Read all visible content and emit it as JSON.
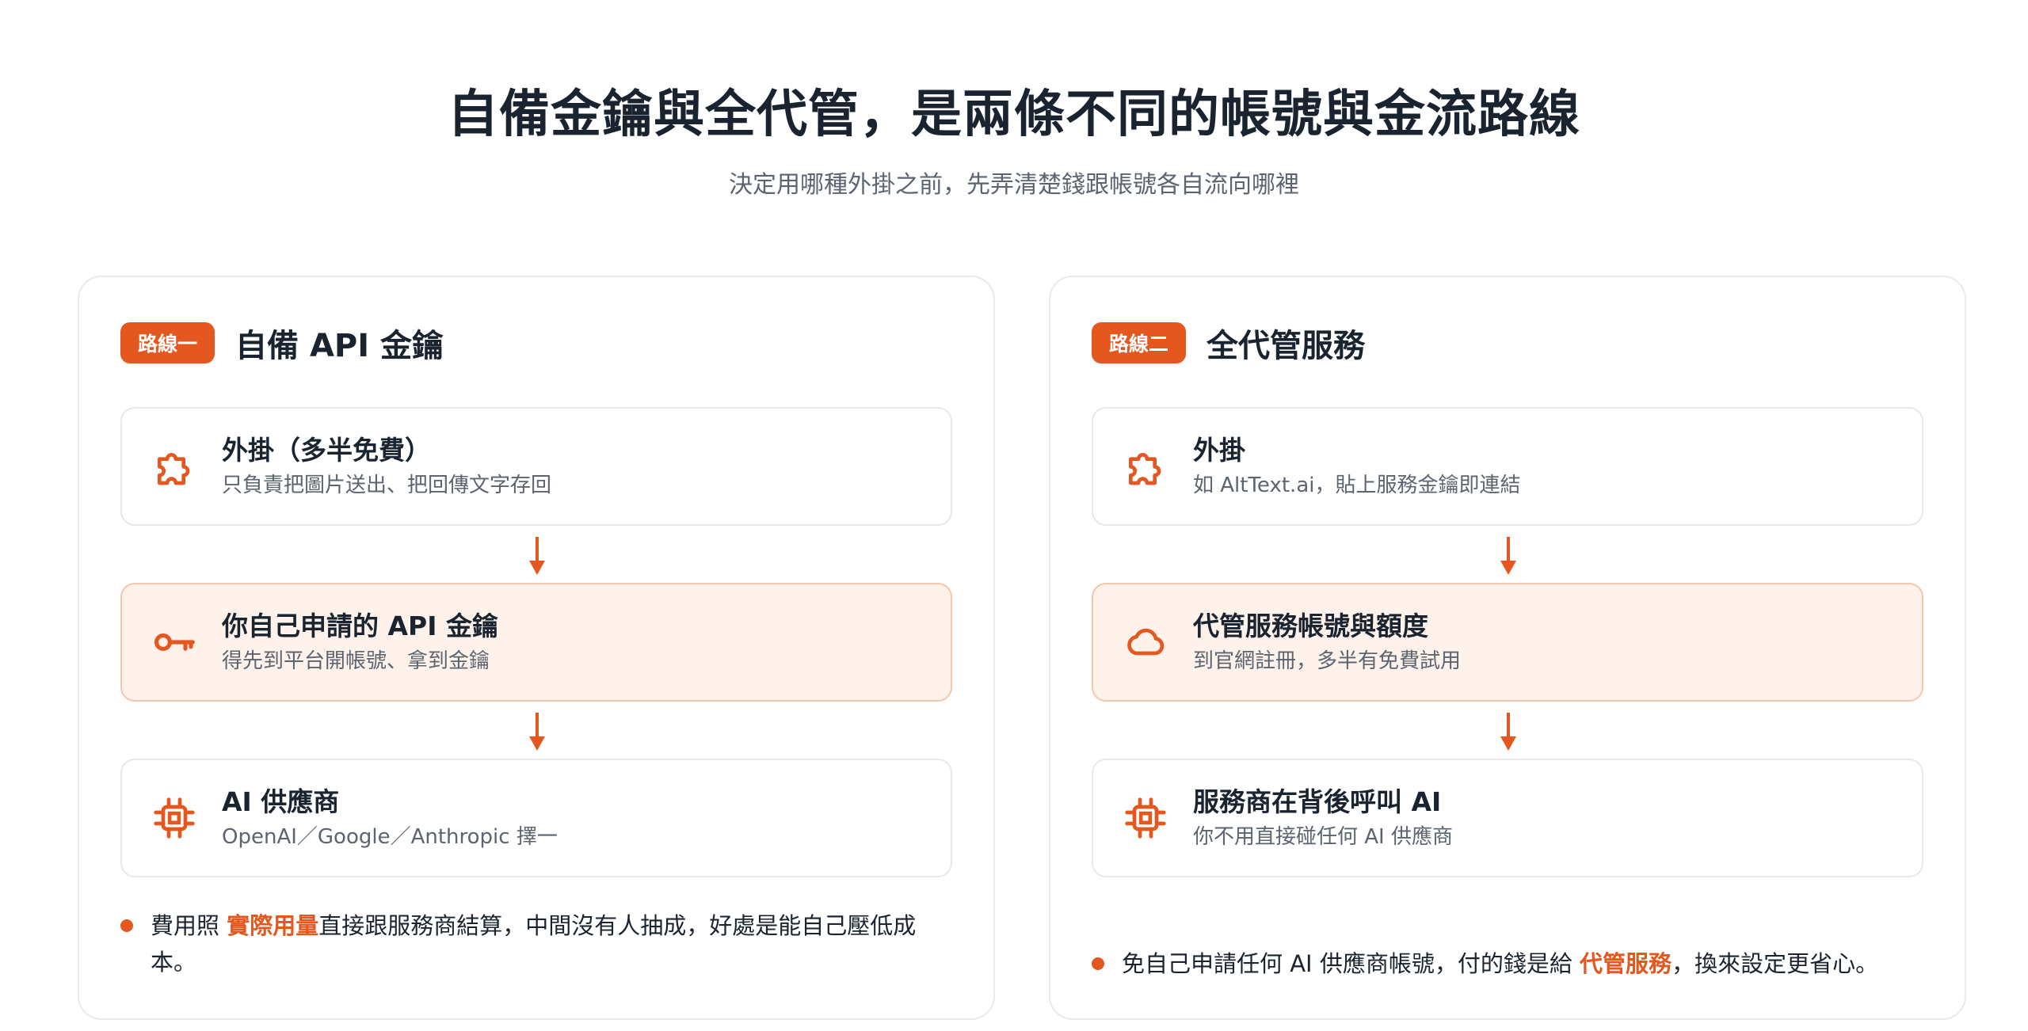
{
  "header": {
    "title": "自備金鑰與全代管，是兩條不同的帳號與金流路線",
    "subtitle": "決定用哪種外掛之前，先弄清楚錢跟帳號各自流向哪裡"
  },
  "routes": [
    {
      "badge": "路線一",
      "title": "自備 API 金鑰",
      "steps": [
        {
          "icon": "puzzle-icon",
          "title": "外掛（多半免費）",
          "desc": "只負責把圖片送出、把回傳文字存回"
        },
        {
          "icon": "key-icon",
          "title": "你自己申請的 API 金鑰",
          "desc": "得先到平台開帳號、拿到金鑰"
        },
        {
          "icon": "chip-icon",
          "title": "AI 供應商",
          "desc": "OpenAI／Google／Anthropic 擇一"
        }
      ],
      "note": {
        "before": "費用照 ",
        "highlight": "實際用量",
        "after": "直接跟服務商結算，中間沒有人抽成，好處是能自己壓低成本。"
      }
    },
    {
      "badge": "路線二",
      "title": "全代管服務",
      "steps": [
        {
          "icon": "puzzle-icon",
          "title": "外掛",
          "desc": "如 AltText.ai，貼上服務金鑰即連結"
        },
        {
          "icon": "cloud-icon",
          "title": "代管服務帳號與額度",
          "desc": "到官網註冊，多半有免費試用"
        },
        {
          "icon": "chip-icon",
          "title": "服務商在背後呼叫 AI",
          "desc": "你不用直接碰任何 AI 供應商"
        }
      ],
      "note": {
        "before": "免自己申請任何 AI 供應商帳號，付的錢是給 ",
        "highlight": "代管服務",
        "after": "，換來設定更省心。"
      }
    }
  ],
  "colors": {
    "accent": "#e4571f",
    "highlight_bg": "#fef2ea",
    "text": "#1a2430",
    "muted": "#5b6470"
  }
}
